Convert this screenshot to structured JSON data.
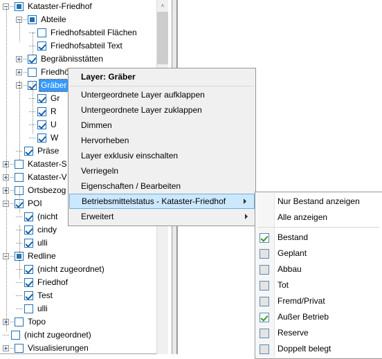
{
  "tree": {
    "scrollbar": {
      "up_arrow": "˄"
    },
    "items": [
      {
        "label": "Kataster-Friedhof",
        "depth": 0,
        "expander": "minus",
        "check": "partial",
        "selected": false
      },
      {
        "label": "Abteile",
        "depth": 1,
        "expander": "minus",
        "check": "partial",
        "selected": false
      },
      {
        "label": "Friedhofsabteil Flächen",
        "depth": 2,
        "expander": "none",
        "check": "unchecked",
        "selected": false
      },
      {
        "label": "Friedhofsabteil Text",
        "depth": 2,
        "expander": "none",
        "check": "checked",
        "selected": false
      },
      {
        "label": "Begräbnisstätten",
        "depth": 1,
        "expander": "plus",
        "check": "checked",
        "selected": false
      },
      {
        "label": "Friedhöfe",
        "depth": 1,
        "expander": "plus",
        "check": "unchecked",
        "selected": false
      },
      {
        "label": "Gräber",
        "depth": 1,
        "expander": "minus",
        "check": "checked",
        "selected": true
      },
      {
        "label": "Gr",
        "depth": 2,
        "expander": "none",
        "check": "checked",
        "selected": false
      },
      {
        "label": "R",
        "depth": 2,
        "expander": "none",
        "check": "checked",
        "selected": false
      },
      {
        "label": "U",
        "depth": 2,
        "expander": "none",
        "check": "checked",
        "selected": false
      },
      {
        "label": "W",
        "depth": 2,
        "expander": "none",
        "check": "checked",
        "selected": false
      },
      {
        "label": "Präse",
        "depth": 1,
        "expander": "none",
        "check": "checked",
        "selected": false
      },
      {
        "label": "Kataster-S",
        "depth": 0,
        "expander": "plus",
        "check": "unchecked",
        "selected": false
      },
      {
        "label": "Kataster-V",
        "depth": 0,
        "expander": "plus",
        "check": "unchecked",
        "selected": false
      },
      {
        "label": "Ortsbezog",
        "depth": 0,
        "expander": "plus",
        "check": "unchecked",
        "selected": false
      },
      {
        "label": "POI",
        "depth": 0,
        "expander": "minus",
        "check": "checked",
        "selected": false
      },
      {
        "label": "(nicht",
        "depth": 1,
        "expander": "none",
        "check": "checked",
        "selected": false
      },
      {
        "label": "cindy",
        "depth": 1,
        "expander": "none",
        "check": "checked",
        "selected": false
      },
      {
        "label": "ulli",
        "depth": 1,
        "expander": "none",
        "check": "checked",
        "selected": false
      },
      {
        "label": "Redline",
        "depth": 0,
        "expander": "minus",
        "check": "partial",
        "selected": false
      },
      {
        "label": "(nicht zugeordnet)",
        "depth": 1,
        "expander": "none",
        "check": "checked",
        "selected": false
      },
      {
        "label": "Friedhof",
        "depth": 1,
        "expander": "none",
        "check": "checked",
        "selected": false
      },
      {
        "label": "Test",
        "depth": 1,
        "expander": "none",
        "check": "checked",
        "selected": false
      },
      {
        "label": "ulli",
        "depth": 1,
        "expander": "none",
        "check": "unchecked",
        "selected": false
      },
      {
        "label": "Topo",
        "depth": 0,
        "expander": "plus",
        "check": "unchecked",
        "selected": false
      },
      {
        "label": "(nicht zugeordnet)",
        "depth": 0,
        "expander": "none",
        "check": "unchecked",
        "selected": false
      },
      {
        "label": "Visualisierungen",
        "depth": 0,
        "expander": "plus",
        "check": "unchecked",
        "selected": false
      }
    ]
  },
  "context_menu": {
    "header": "Layer: Gräber",
    "items": [
      {
        "label": "Untergeordnete Layer aufklappen",
        "submenu": false,
        "highlight": false
      },
      {
        "label": "Untergeordnete Layer zuklappen",
        "submenu": false,
        "highlight": false
      },
      {
        "label": "Dimmen",
        "submenu": false,
        "highlight": false
      },
      {
        "label": "Hervorheben",
        "submenu": false,
        "highlight": false
      },
      {
        "label": "Layer exklusiv einschalten",
        "submenu": false,
        "highlight": false
      },
      {
        "label": "Verriegeln",
        "submenu": false,
        "highlight": false
      },
      {
        "label": "Eigenschaften / Bearbeiten",
        "submenu": false,
        "highlight": false
      },
      {
        "label": "Betriebsmittelstatus - Kataster-Friedhof",
        "submenu": true,
        "highlight": true
      },
      {
        "label": "Erweitert",
        "submenu": true,
        "highlight": false
      }
    ]
  },
  "submenu": {
    "actions": [
      {
        "label": "Nur Bestand anzeigen"
      },
      {
        "label": "Alle anzeigen"
      }
    ],
    "options": [
      {
        "label": "Bestand",
        "checked": true
      },
      {
        "label": "Geplant",
        "checked": false
      },
      {
        "label": "Abbau",
        "checked": false
      },
      {
        "label": "Tot",
        "checked": false
      },
      {
        "label": "Fremd/Privat",
        "checked": false
      },
      {
        "label": "Außer Betrieb",
        "checked": true
      },
      {
        "label": "Reserve",
        "checked": false
      },
      {
        "label": "Doppelt belegt",
        "checked": false
      }
    ]
  },
  "colors": {
    "selection": "#3399ff",
    "menu_highlight": "#cce8ff",
    "menu_highlight_border": "#6cacda",
    "checkbox_border": "#1f6fb3",
    "check_green": "#339933",
    "menu_bg": "#f0f0f0"
  }
}
